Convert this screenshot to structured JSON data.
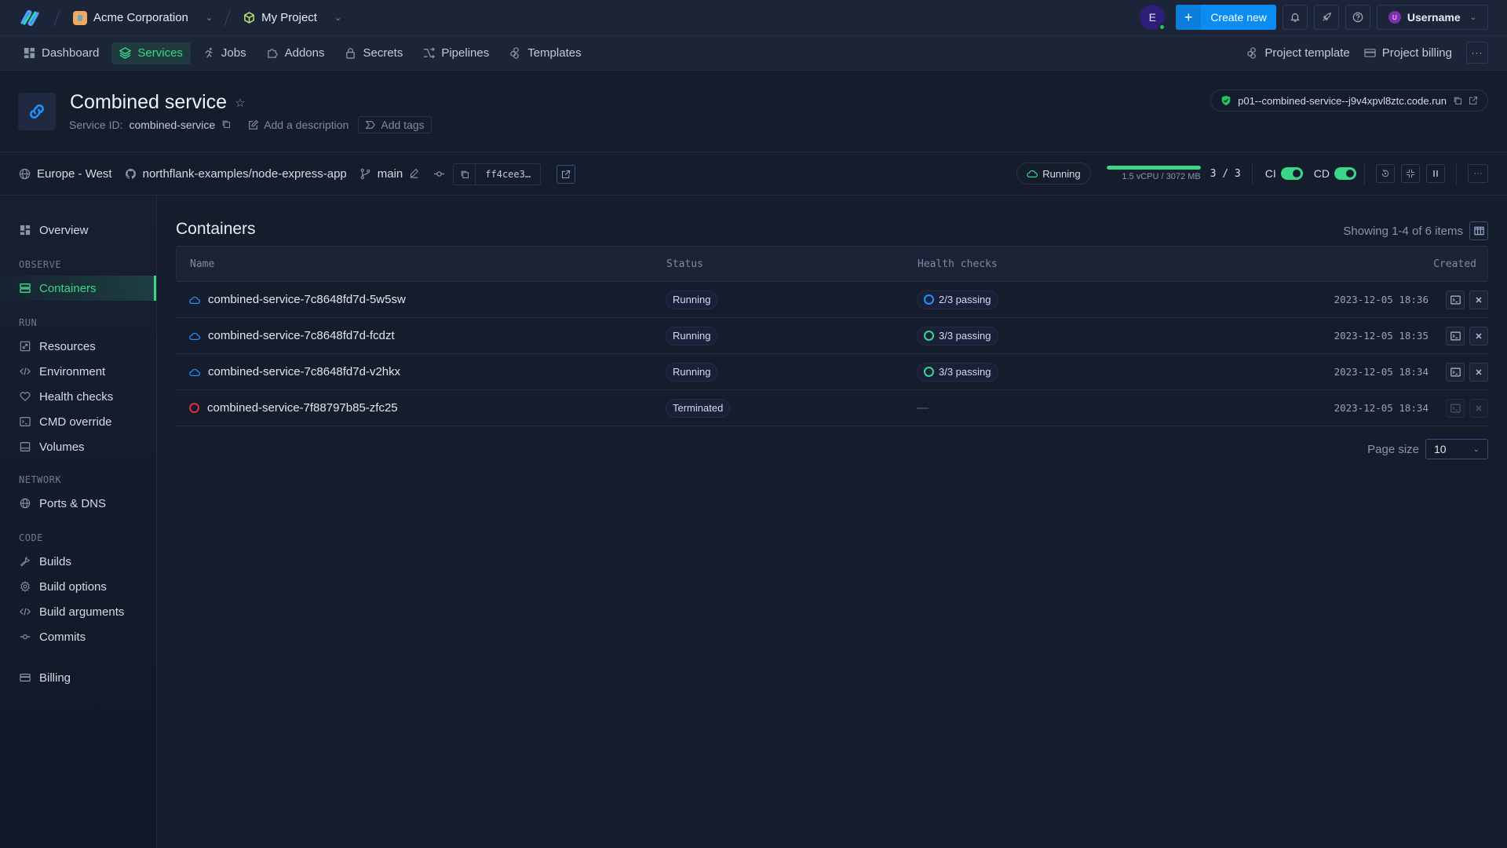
{
  "topbar": {
    "org": "Acme Corporation",
    "project": "My Project",
    "avatar_initial": "E",
    "create_label": "Create new",
    "username": "Username",
    "user_initial": "U"
  },
  "nav": {
    "items": [
      {
        "label": "Dashboard",
        "icon": "dashboard-icon"
      },
      {
        "label": "Services",
        "icon": "layers-icon",
        "active": true
      },
      {
        "label": "Jobs",
        "icon": "runner-icon"
      },
      {
        "label": "Addons",
        "icon": "puzzle-icon"
      },
      {
        "label": "Secrets",
        "icon": "lock-icon"
      },
      {
        "label": "Pipelines",
        "icon": "shuffle-icon"
      },
      {
        "label": "Templates",
        "icon": "templates-icon"
      }
    ],
    "project_template": "Project template",
    "project_billing": "Project billing"
  },
  "service": {
    "title": "Combined service",
    "id_label": "Service ID:",
    "id": "combined-service",
    "add_description": "Add a description",
    "add_tags": "Add tags",
    "url": "p01--combined-service--j9v4xpvl8ztc.code.run"
  },
  "info": {
    "region": "Europe - West",
    "repo": "northflank-examples/node-express-app",
    "branch": "main",
    "commit": "ff4cee3…",
    "status": "Running",
    "resources": "1.5 vCPU / 3072 MB",
    "resources_fill": 1.0,
    "instances": "3 / 3",
    "ci_label": "CI",
    "ci_enabled": true,
    "cd_label": "CD",
    "cd_enabled": true
  },
  "sidebar": {
    "overview": "Overview",
    "sections": {
      "observe": "OBSERVE",
      "run": "RUN",
      "network": "NETWORK",
      "code": "CODE"
    },
    "items": {
      "containers": "Containers",
      "resources": "Resources",
      "environment": "Environment",
      "health_checks": "Health checks",
      "cmd_override": "CMD override",
      "volumes": "Volumes",
      "ports_dns": "Ports & DNS",
      "builds": "Builds",
      "build_options": "Build options",
      "build_arguments": "Build arguments",
      "commits": "Commits",
      "billing": "Billing"
    }
  },
  "main": {
    "title": "Containers",
    "showing": "Showing 1-4 of 6 items",
    "columns": {
      "name": "Name",
      "status": "Status",
      "health": "Health checks",
      "created": "Created"
    },
    "rows": [
      {
        "name": "combined-service-7c8648fd7d-5w5sw",
        "status": "Running",
        "health": "2/3 passing",
        "health_state": "partial",
        "created": "2023-12-05 18:36"
      },
      {
        "name": "combined-service-7c8648fd7d-fcdzt",
        "status": "Running",
        "health": "3/3 passing",
        "health_state": "ok",
        "created": "2023-12-05 18:35"
      },
      {
        "name": "combined-service-7c8648fd7d-v2hkx",
        "status": "Running",
        "health": "3/3 passing",
        "health_state": "ok",
        "created": "2023-12-05 18:34"
      },
      {
        "name": "combined-service-7f88797b85-zfc25",
        "status": "Terminated",
        "health": "—",
        "health_state": "none",
        "created": "2023-12-05 18:34"
      }
    ],
    "page_size_label": "Page size",
    "page_size": "10"
  },
  "colors": {
    "accent_green": "#3ad68a",
    "accent_blue": "#1e90ff",
    "error_red": "#e02f3a",
    "background": "#151c2c"
  }
}
